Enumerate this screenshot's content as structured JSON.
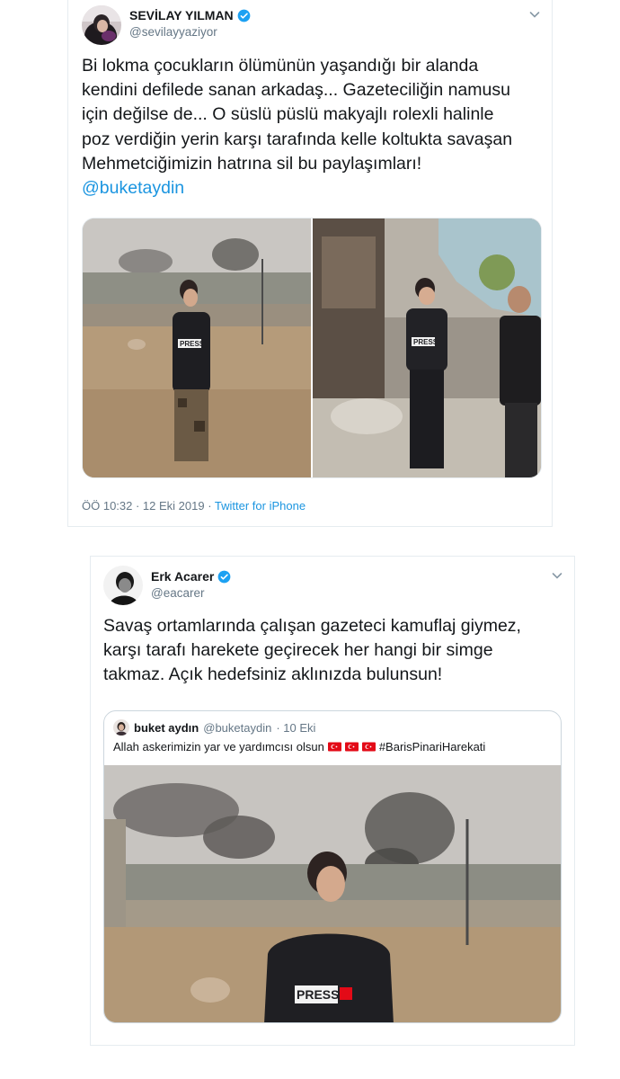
{
  "tweet1": {
    "display_name": "SEVİLAY YILMAN",
    "handle": "@sevilayyaziyor",
    "text_lines": [
      "Bi lokma çocukların ölümünün yaşandığı bir alanda",
      "kendini defilede sanan arkadaş... Gazeteciliğin namusu",
      "için değilse de... O süslü püslü makyajlı rolexli halinle",
      "poz verdiğin yerin karşı tarafında kelle koltukta savaşan",
      "Mehmetciğimizin hatrına sil bu paylaşımları!"
    ],
    "mention": "@buketaydin",
    "timestamp": "ÖÖ 10:32 · 12 Eki 2019 · ",
    "source": "Twitter for iPhone",
    "image_text": "PRESS"
  },
  "tweet2": {
    "display_name": "Erk Acarer",
    "handle": "@eacarer",
    "text_lines": [
      "Savaş ortamlarında çalışan gazeteci kamuflaj giymez,",
      "karşı tarafı harekete geçirecek her hangi bir simge",
      "takmaz. Açık hedefsiniz aklınızda bulunsun!"
    ],
    "quoted": {
      "display_name": "buket aydın",
      "handle": "@buketaydin",
      "date": "· 10 Eki",
      "text": "Allah askerimizin yar ve yardımcısı olsun",
      "hashtag": "#BarisPinariHarekati",
      "image_text": "PRESS"
    }
  },
  "colors": {
    "link": "#1b95e0",
    "secondary_text": "#657786",
    "border": "#e6ecf0",
    "verified": "#1da1f2",
    "flag_red": "#e30a17"
  },
  "icons": [
    "verified-badge-icon",
    "chevron-down-icon",
    "turkish-flag-icon"
  ]
}
